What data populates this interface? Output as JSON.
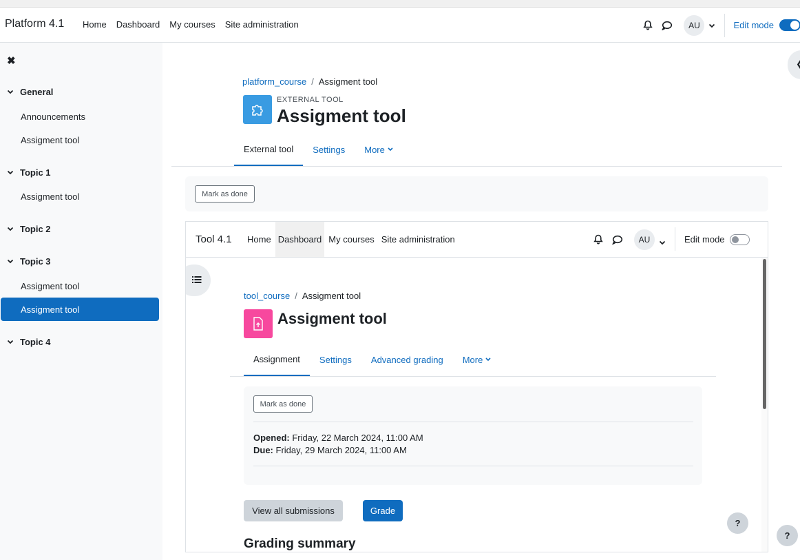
{
  "navbar": {
    "brand": "Platform 4.1",
    "links": [
      "Home",
      "Dashboard",
      "My courses",
      "Site administration"
    ],
    "avatar": "AU",
    "edit_mode": "Edit mode"
  },
  "drawer": {
    "sections": [
      {
        "title": "General",
        "items": [
          "Announcements",
          "Assigment tool"
        ]
      },
      {
        "title": "Topic 1",
        "items": [
          "Assigment tool"
        ]
      },
      {
        "title": "Topic 2",
        "items": []
      },
      {
        "title": "Topic 3",
        "items": [
          "Assigment tool",
          "Assigment tool"
        ]
      },
      {
        "title": "Topic 4",
        "items": []
      }
    ]
  },
  "page": {
    "breadcrumb": {
      "course": "platform_course",
      "separator": "/",
      "current": "Assigment tool"
    },
    "eyebrow": "EXTERNAL TOOL",
    "title": "Assigment tool",
    "tabs": [
      "External tool",
      "Settings",
      "More"
    ],
    "mark_done": "Mark as done"
  },
  "frame": {
    "brand": "Tool 4.1",
    "links": [
      "Home",
      "Dashboard",
      "My courses",
      "Site administration"
    ],
    "avatar": "AU",
    "edit_mode": "Edit mode",
    "breadcrumb": {
      "course": "tool_course",
      "separator": "/",
      "current": "Assigment tool"
    },
    "title": "Assigment tool",
    "tabs": [
      "Assignment",
      "Settings",
      "Advanced grading",
      "More"
    ],
    "mark_done": "Mark as done",
    "opened_label": "Opened:",
    "opened_value": "Friday, 22 March 2024, 11:00 AM",
    "due_label": "Due:",
    "due_value": "Friday, 29 March 2024, 11:00 AM",
    "view_all": "View all submissions",
    "grade": "Grade",
    "grading_summary": "Grading summary"
  },
  "help": "?",
  "colors": {
    "primary": "#0f6cbf",
    "external_tool_icon": "#399be2",
    "assign_icon": "#f7489e"
  }
}
